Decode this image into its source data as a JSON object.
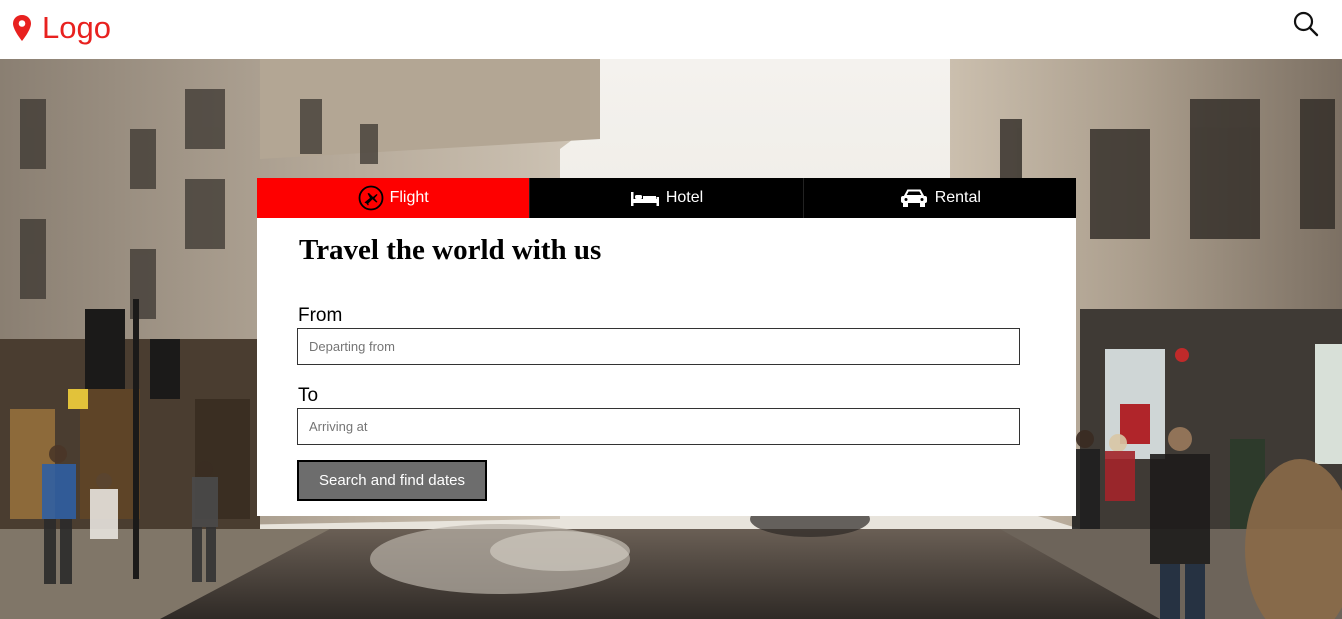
{
  "header": {
    "logo_text": "Logo",
    "logo_icon": "map-pin-icon",
    "search_icon": "search-icon",
    "brand_color": "#e8211f"
  },
  "booking": {
    "tabs": [
      {
        "label": "Flight",
        "icon": "airplane-icon",
        "active": true
      },
      {
        "label": "Hotel",
        "icon": "bed-icon",
        "active": false
      },
      {
        "label": "Rental",
        "icon": "car-icon",
        "active": false
      }
    ],
    "heading": "Travel the world with us",
    "from": {
      "label": "From",
      "placeholder": "Departing from",
      "value": ""
    },
    "to": {
      "label": "To",
      "placeholder": "Arriving at",
      "value": ""
    },
    "submit_label": "Search and find dates",
    "active_tab_color": "#fe0000"
  }
}
